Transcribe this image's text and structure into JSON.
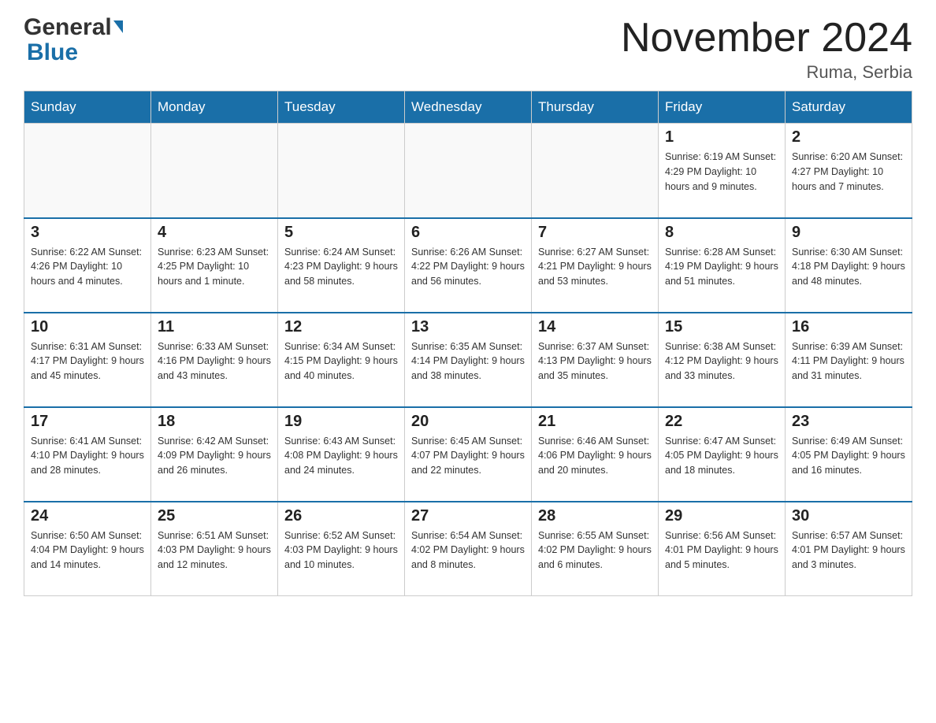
{
  "header": {
    "logo_general": "General",
    "logo_blue": "Blue",
    "month_title": "November 2024",
    "location": "Ruma, Serbia"
  },
  "days_of_week": [
    "Sunday",
    "Monday",
    "Tuesday",
    "Wednesday",
    "Thursday",
    "Friday",
    "Saturday"
  ],
  "weeks": [
    [
      {
        "day": "",
        "info": ""
      },
      {
        "day": "",
        "info": ""
      },
      {
        "day": "",
        "info": ""
      },
      {
        "day": "",
        "info": ""
      },
      {
        "day": "",
        "info": ""
      },
      {
        "day": "1",
        "info": "Sunrise: 6:19 AM\nSunset: 4:29 PM\nDaylight: 10 hours and 9 minutes."
      },
      {
        "day": "2",
        "info": "Sunrise: 6:20 AM\nSunset: 4:27 PM\nDaylight: 10 hours and 7 minutes."
      }
    ],
    [
      {
        "day": "3",
        "info": "Sunrise: 6:22 AM\nSunset: 4:26 PM\nDaylight: 10 hours and 4 minutes."
      },
      {
        "day": "4",
        "info": "Sunrise: 6:23 AM\nSunset: 4:25 PM\nDaylight: 10 hours and 1 minute."
      },
      {
        "day": "5",
        "info": "Sunrise: 6:24 AM\nSunset: 4:23 PM\nDaylight: 9 hours and 58 minutes."
      },
      {
        "day": "6",
        "info": "Sunrise: 6:26 AM\nSunset: 4:22 PM\nDaylight: 9 hours and 56 minutes."
      },
      {
        "day": "7",
        "info": "Sunrise: 6:27 AM\nSunset: 4:21 PM\nDaylight: 9 hours and 53 minutes."
      },
      {
        "day": "8",
        "info": "Sunrise: 6:28 AM\nSunset: 4:19 PM\nDaylight: 9 hours and 51 minutes."
      },
      {
        "day": "9",
        "info": "Sunrise: 6:30 AM\nSunset: 4:18 PM\nDaylight: 9 hours and 48 minutes."
      }
    ],
    [
      {
        "day": "10",
        "info": "Sunrise: 6:31 AM\nSunset: 4:17 PM\nDaylight: 9 hours and 45 minutes."
      },
      {
        "day": "11",
        "info": "Sunrise: 6:33 AM\nSunset: 4:16 PM\nDaylight: 9 hours and 43 minutes."
      },
      {
        "day": "12",
        "info": "Sunrise: 6:34 AM\nSunset: 4:15 PM\nDaylight: 9 hours and 40 minutes."
      },
      {
        "day": "13",
        "info": "Sunrise: 6:35 AM\nSunset: 4:14 PM\nDaylight: 9 hours and 38 minutes."
      },
      {
        "day": "14",
        "info": "Sunrise: 6:37 AM\nSunset: 4:13 PM\nDaylight: 9 hours and 35 minutes."
      },
      {
        "day": "15",
        "info": "Sunrise: 6:38 AM\nSunset: 4:12 PM\nDaylight: 9 hours and 33 minutes."
      },
      {
        "day": "16",
        "info": "Sunrise: 6:39 AM\nSunset: 4:11 PM\nDaylight: 9 hours and 31 minutes."
      }
    ],
    [
      {
        "day": "17",
        "info": "Sunrise: 6:41 AM\nSunset: 4:10 PM\nDaylight: 9 hours and 28 minutes."
      },
      {
        "day": "18",
        "info": "Sunrise: 6:42 AM\nSunset: 4:09 PM\nDaylight: 9 hours and 26 minutes."
      },
      {
        "day": "19",
        "info": "Sunrise: 6:43 AM\nSunset: 4:08 PM\nDaylight: 9 hours and 24 minutes."
      },
      {
        "day": "20",
        "info": "Sunrise: 6:45 AM\nSunset: 4:07 PM\nDaylight: 9 hours and 22 minutes."
      },
      {
        "day": "21",
        "info": "Sunrise: 6:46 AM\nSunset: 4:06 PM\nDaylight: 9 hours and 20 minutes."
      },
      {
        "day": "22",
        "info": "Sunrise: 6:47 AM\nSunset: 4:05 PM\nDaylight: 9 hours and 18 minutes."
      },
      {
        "day": "23",
        "info": "Sunrise: 6:49 AM\nSunset: 4:05 PM\nDaylight: 9 hours and 16 minutes."
      }
    ],
    [
      {
        "day": "24",
        "info": "Sunrise: 6:50 AM\nSunset: 4:04 PM\nDaylight: 9 hours and 14 minutes."
      },
      {
        "day": "25",
        "info": "Sunrise: 6:51 AM\nSunset: 4:03 PM\nDaylight: 9 hours and 12 minutes."
      },
      {
        "day": "26",
        "info": "Sunrise: 6:52 AM\nSunset: 4:03 PM\nDaylight: 9 hours and 10 minutes."
      },
      {
        "day": "27",
        "info": "Sunrise: 6:54 AM\nSunset: 4:02 PM\nDaylight: 9 hours and 8 minutes."
      },
      {
        "day": "28",
        "info": "Sunrise: 6:55 AM\nSunset: 4:02 PM\nDaylight: 9 hours and 6 minutes."
      },
      {
        "day": "29",
        "info": "Sunrise: 6:56 AM\nSunset: 4:01 PM\nDaylight: 9 hours and 5 minutes."
      },
      {
        "day": "30",
        "info": "Sunrise: 6:57 AM\nSunset: 4:01 PM\nDaylight: 9 hours and 3 minutes."
      }
    ]
  ]
}
